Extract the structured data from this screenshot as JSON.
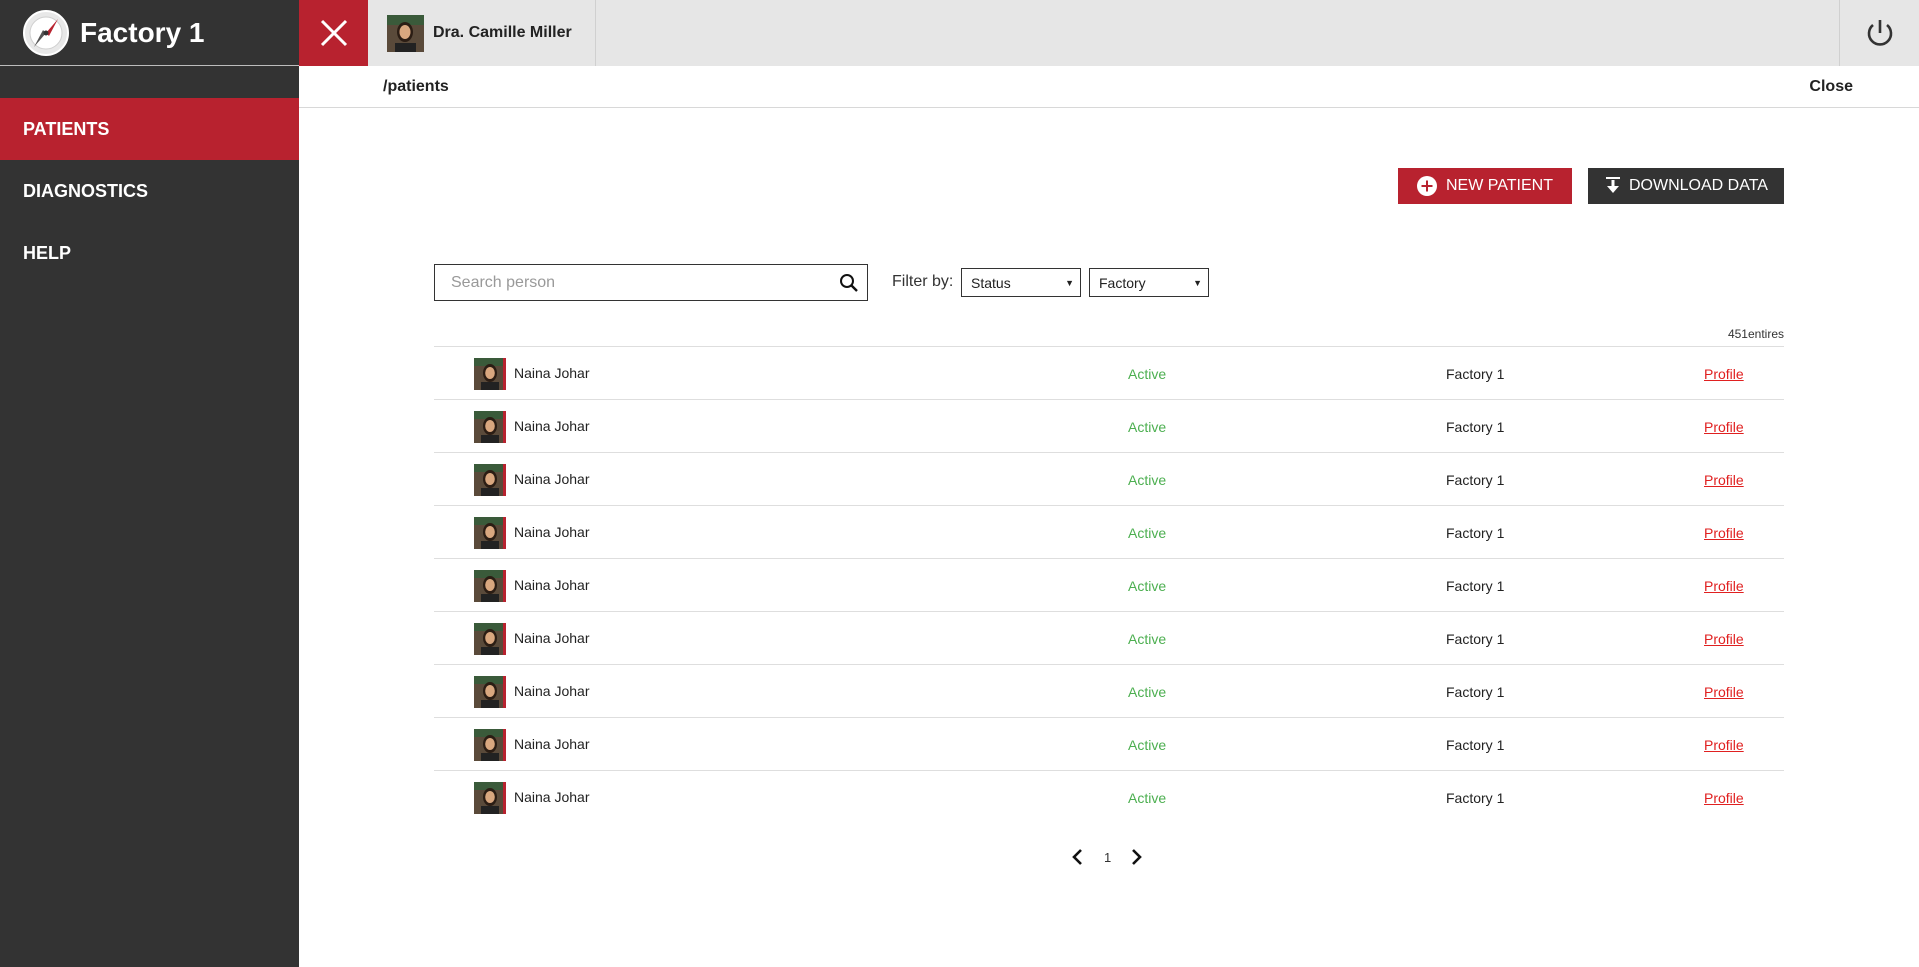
{
  "app": {
    "title": "Factory 1"
  },
  "sidebar": {
    "items": [
      {
        "label": "PATIENTS",
        "active": true
      },
      {
        "label": "DIAGNOSTICS",
        "active": false
      },
      {
        "label": "HELP",
        "active": false
      }
    ]
  },
  "topbar": {
    "user_name": "Dra. Camille Miller"
  },
  "breadcrumb": {
    "path": "/patients",
    "close_label": "Close"
  },
  "actions": {
    "new_patient": "NEW PATIENT",
    "download": "DOWNLOAD DATA"
  },
  "search": {
    "placeholder": "Search person",
    "value": ""
  },
  "filter": {
    "label": "Filter by:",
    "status": "Status",
    "factory": "Factory"
  },
  "entries_label": "451entires",
  "patients": [
    {
      "name": "Naina Johar",
      "status": "Active",
      "factory": "Factory 1",
      "link": "Profile"
    },
    {
      "name": "Naina Johar",
      "status": "Active",
      "factory": "Factory 1",
      "link": "Profile"
    },
    {
      "name": "Naina Johar",
      "status": "Active",
      "factory": "Factory 1",
      "link": "Profile"
    },
    {
      "name": "Naina Johar",
      "status": "Active",
      "factory": "Factory 1",
      "link": "Profile"
    },
    {
      "name": "Naina Johar",
      "status": "Active",
      "factory": "Factory 1",
      "link": "Profile"
    },
    {
      "name": "Naina Johar",
      "status": "Active",
      "factory": "Factory 1",
      "link": "Profile"
    },
    {
      "name": "Naina Johar",
      "status": "Active",
      "factory": "Factory 1",
      "link": "Profile"
    },
    {
      "name": "Naina Johar",
      "status": "Active",
      "factory": "Factory 1",
      "link": "Profile"
    },
    {
      "name": "Naina Johar",
      "status": "Active",
      "factory": "Factory 1",
      "link": "Profile"
    }
  ],
  "pagination": {
    "current": "1"
  },
  "colors": {
    "accent": "#b8222f",
    "sidebar": "#333333",
    "status_active": "#4caf50",
    "link": "#e02020"
  },
  "icons": {
    "logo": "compass-logo-icon",
    "close": "close-icon",
    "power": "power-icon",
    "add": "plus-circle-icon",
    "download": "download-icon",
    "search": "search-icon",
    "prev": "chevron-left-icon",
    "next": "chevron-right-icon"
  }
}
